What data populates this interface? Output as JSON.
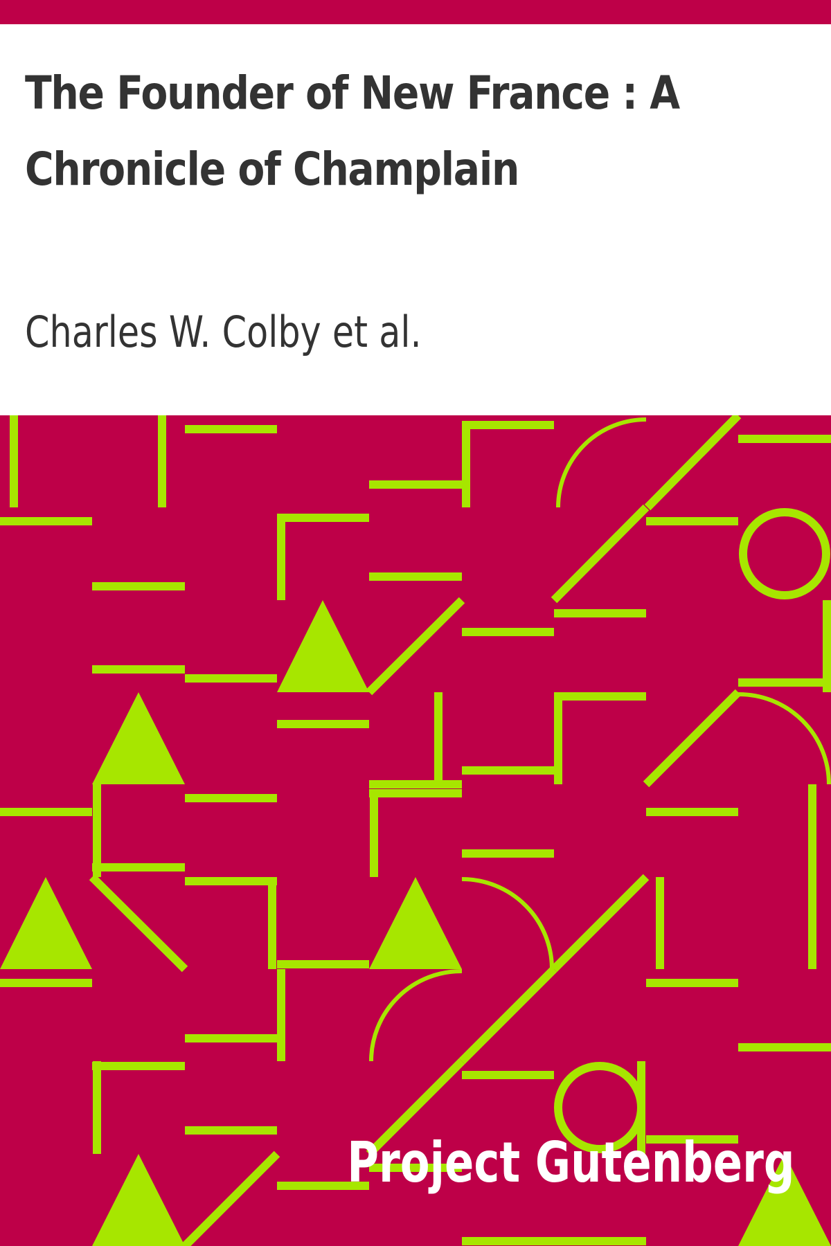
{
  "book": {
    "title": "The Founder of New France : A Chronicle of Champlain",
    "author": "Charles W. Colby et al.",
    "publisher": "Project Gutenberg"
  },
  "colors": {
    "accent": "#be0048",
    "pattern": "#a7e600",
    "text": "#333333",
    "publisher_text": "#ffffff",
    "background": "#ffffff"
  },
  "pattern": {
    "style": "geometric-tiles",
    "shapes": [
      "line",
      "corner",
      "diagonal",
      "triangle",
      "circle",
      "arc"
    ]
  }
}
